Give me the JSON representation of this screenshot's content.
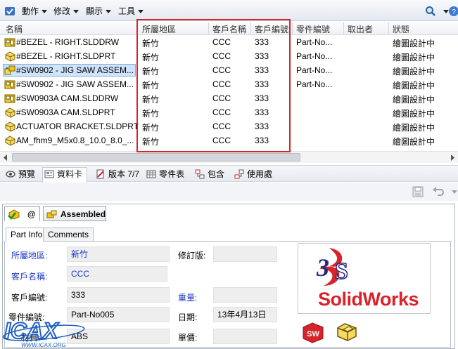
{
  "toolbar": {
    "items": [
      {
        "label": "動作"
      },
      {
        "label": "修改"
      },
      {
        "label": "顯示"
      },
      {
        "label": "工具"
      }
    ]
  },
  "columns": [
    "名稱",
    "所屬地區",
    "客戶名稱",
    "客戶編號",
    "零件編號",
    "取出者",
    "狀態"
  ],
  "rows": [
    {
      "name": "#BEZEL - RIGHT.SLDDRW",
      "type": "drawing",
      "region": "新竹",
      "customer": "CCC",
      "custno": "333",
      "partno": "Part-No...",
      "checkout": "",
      "status": "繪圖設計中"
    },
    {
      "name": "#BEZEL - RIGHT.SLDPRT",
      "type": "part",
      "region": "新竹",
      "customer": "CCC",
      "custno": "333",
      "partno": "Part-No...",
      "checkout": "",
      "status": "繪圖設計中"
    },
    {
      "name": "#SW0902 - JIG SAW ASSEM...",
      "type": "assembly",
      "region": "新竹",
      "customer": "CCC",
      "custno": "333",
      "partno": "Part-No...",
      "checkout": "",
      "status": "繪圖設計中"
    },
    {
      "name": "#SW0902 - JIG SAW ASSEM...",
      "type": "drawing",
      "region": "新竹",
      "customer": "CCC",
      "custno": "333",
      "partno": "Part-No...",
      "checkout": "",
      "status": "繪圖設計中"
    },
    {
      "name": "#SW0903A CAM.SLDDRW",
      "type": "drawing",
      "region": "新竹",
      "customer": "CCC",
      "custno": "333",
      "partno": "",
      "checkout": "",
      "status": "繪圖設計中"
    },
    {
      "name": "#SW0903A CAM.SLDPRT",
      "type": "part",
      "region": "新竹",
      "customer": "CCC",
      "custno": "333",
      "partno": "",
      "checkout": "",
      "status": "繪圖設計中"
    },
    {
      "name": "ACTUATOR BRACKET.SLDPRT",
      "type": "part",
      "region": "新竹",
      "customer": "CCC",
      "custno": "333",
      "partno": "",
      "checkout": "",
      "status": "繪圖設計中"
    },
    {
      "name": "AM_fhm9_M5x0.8_10.0_8.0_...",
      "type": "part",
      "region": "新竹",
      "customer": "CCC",
      "custno": "333",
      "partno": "",
      "checkout": "",
      "status": "繪圖設計中"
    }
  ],
  "bottom_tabs": [
    {
      "label": "預覽"
    },
    {
      "label": "資料卡"
    },
    {
      "label": "版本 7/7"
    },
    {
      "label": "零件表"
    },
    {
      "label": "包含"
    },
    {
      "label": "使用處"
    }
  ],
  "form_tabs": {
    "at_label": "@",
    "config_label": "Assembled"
  },
  "sub_tabs": {
    "part_info": "Part Info",
    "comments": "Comments"
  },
  "form": {
    "region_label": "所屬地區:",
    "region_value": "新竹",
    "customer_label": "客戶名稱:",
    "customer_value": "CCC",
    "custno_label": "客戶編號:",
    "custno_value": "333",
    "partno_label": "零件編號:",
    "partno_value": "Part-No005",
    "material_label": "材質:",
    "material_value": "ABS",
    "revision_label": "修訂版:",
    "revision_value": "",
    "weight_label": "重量:",
    "weight_value": "",
    "date_label": "日期:",
    "date_value": "13年4月13日",
    "price_label": "單價:",
    "price_value": ""
  },
  "logo": {
    "brand": "SolidWorks"
  },
  "watermark": {
    "text": "ICAX",
    "url": "WWW.ICAX.ORG"
  },
  "colors": {
    "highlight_border": "#d9232a",
    "selection": "#cfe3fb",
    "link_blue": "#1f39c8",
    "brand_red": "#d9232a"
  }
}
